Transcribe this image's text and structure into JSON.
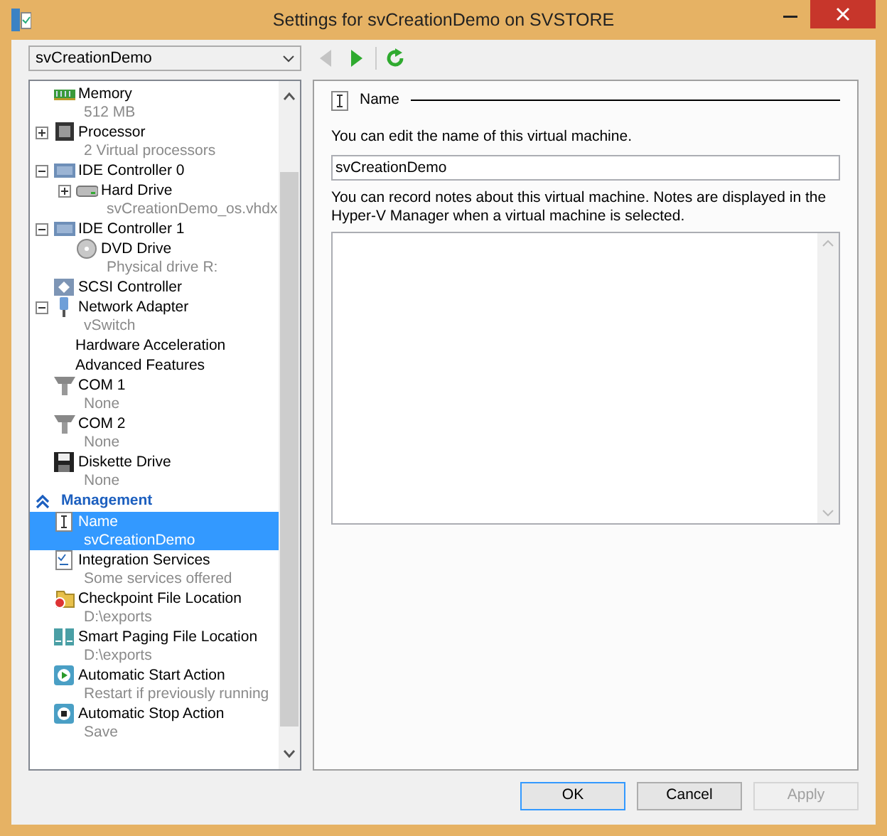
{
  "window": {
    "title": "Settings for svCreationDemo on SVSTORE"
  },
  "vm_selector": {
    "value": "svCreationDemo"
  },
  "navigation": [
    {
      "kind": "back",
      "disabled": true
    },
    {
      "kind": "forward",
      "disabled": false
    },
    {
      "kind": "refresh",
      "disabled": false
    }
  ],
  "tree": {
    "items": [
      {
        "kind": "memory",
        "label": "Memory",
        "detail": "512 MB",
        "selected": false
      },
      {
        "kind": "processor",
        "label": "Processor",
        "detail": "2 Virtual processors",
        "expanded": false,
        "selected": false
      },
      {
        "kind": "controller",
        "label": "IDE Controller 0",
        "expanded": true,
        "selected": false,
        "children": [
          {
            "kind": "harddrive",
            "label": "Hard Drive",
            "detail": "svCreationDemo_os.vhdx",
            "expanded": false,
            "selected": false
          }
        ]
      },
      {
        "kind": "controller",
        "label": "IDE Controller 1",
        "expanded": true,
        "selected": false,
        "children": [
          {
            "kind": "dvd",
            "label": "DVD Drive",
            "detail": "Physical drive R:",
            "selected": false
          }
        ]
      },
      {
        "kind": "scsi",
        "label": "SCSI Controller",
        "selected": false
      },
      {
        "kind": "network",
        "label": "Network Adapter",
        "detail": "vSwitch",
        "expanded": true,
        "selected": false,
        "children": [
          {
            "kind": "none",
            "label": "Hardware Acceleration",
            "selected": false
          },
          {
            "kind": "none",
            "label": "Advanced Features",
            "selected": false
          }
        ]
      },
      {
        "kind": "com",
        "label": "COM 1",
        "detail": "None",
        "selected": false
      },
      {
        "kind": "com",
        "label": "COM 2",
        "detail": "None",
        "selected": false
      },
      {
        "kind": "floppy",
        "label": "Diskette Drive",
        "detail": "None",
        "selected": false
      }
    ],
    "management": {
      "title": "Management",
      "expanded": true,
      "items": [
        {
          "kind": "name",
          "label": "Name",
          "detail": "svCreationDemo",
          "selected": true
        },
        {
          "kind": "integration",
          "label": "Integration Services",
          "detail": "Some services offered",
          "selected": false
        },
        {
          "kind": "checkpoint",
          "label": "Checkpoint File Location",
          "detail": "D:\\exports",
          "selected": false
        },
        {
          "kind": "paging",
          "label": "Smart Paging File Location",
          "detail": "D:\\exports",
          "selected": false
        },
        {
          "kind": "start",
          "label": "Automatic Start Action",
          "detail": "Restart if previously running",
          "selected": false
        },
        {
          "kind": "stop",
          "label": "Automatic Stop Action",
          "detail": "Save",
          "selected": false
        }
      ]
    }
  },
  "details": {
    "section_title": "Name",
    "name_prompt": "You can edit the name of this virtual machine.",
    "name_value": "svCreationDemo",
    "notes_prompt": "You can record notes about this virtual machine. Notes are displayed in the Hyper-V Manager when a virtual machine is selected."
  },
  "buttons": [
    {
      "label": "OK",
      "kind": "default",
      "disabled": false
    },
    {
      "label": "Cancel",
      "kind": "normal",
      "disabled": false
    },
    {
      "label": "Apply",
      "kind": "normal",
      "disabled": true
    }
  ]
}
